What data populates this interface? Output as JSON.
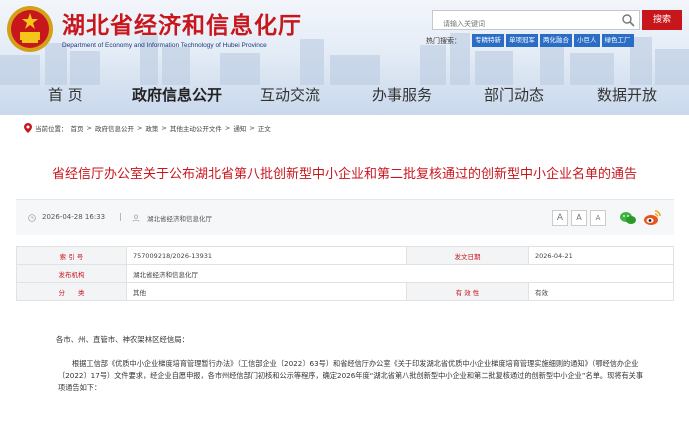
{
  "header": {
    "site_title": "湖北省经济和信息化厅",
    "site_subtitle": "Department of Economy and Information Technology of Hubei Province",
    "search_placeholder": "请输入关键词",
    "search_button": "搜索",
    "hot_label": "热门搜索：",
    "hot_tags": [
      "专精特新",
      "单项冠军",
      "两化融合",
      "小巨人",
      "绿色工厂"
    ],
    "accent": "#c8161d",
    "tag_color": "#2b6cc4"
  },
  "nav": {
    "items": [
      "首 页",
      "政府信息公开",
      "互动交流",
      "办事服务",
      "部门动态",
      "数据开放"
    ],
    "active": "政府信息公开"
  },
  "breadcrumb": {
    "prefix": "当前位置：",
    "items": [
      "首页",
      "政府信息公开",
      "政策",
      "其他主动公开文件",
      "通知",
      "正文"
    ],
    "separator": ">"
  },
  "article": {
    "title": "省经信厅办公室关于公布湖北省第八批创新型中小企业和第二批复核通过的创新型中小企业名单的通告",
    "date": "2026-04-28 16:33",
    "source": "湖北省经济和信息化厅",
    "font_sizes": [
      "A",
      "A",
      "A"
    ]
  },
  "meta": {
    "index_label": "索 引 号",
    "index_value": "757009218/2026-13931",
    "date_label": "发文日期",
    "date_value": "2026-04-21",
    "org_label": "发布机构",
    "org_value": "湖北省经济和信息化厅",
    "category_label": "分　　类",
    "category_value": "其他",
    "validity_label": "有 效 性",
    "validity_value": "有效"
  },
  "body": {
    "salutation": "各市、州、直管市、神农架林区经信局：",
    "paragraph": "根据工信部《优质中小企业梯度培育管理暂行办法》（工信部企业〔2022〕63号）和省经信厅办公室《关于印发湖北省优质中小企业梯度培育管理实施细则的通知》（鄂经信办企业〔2022〕17号）文件要求，经企业自愿申报，各市州经信部门初核和公示等程序，确定2026年度“湖北省第八批创新型中小企业和第二批复核通过的创新型中小企业”名单。现将有关事项通告如下："
  }
}
